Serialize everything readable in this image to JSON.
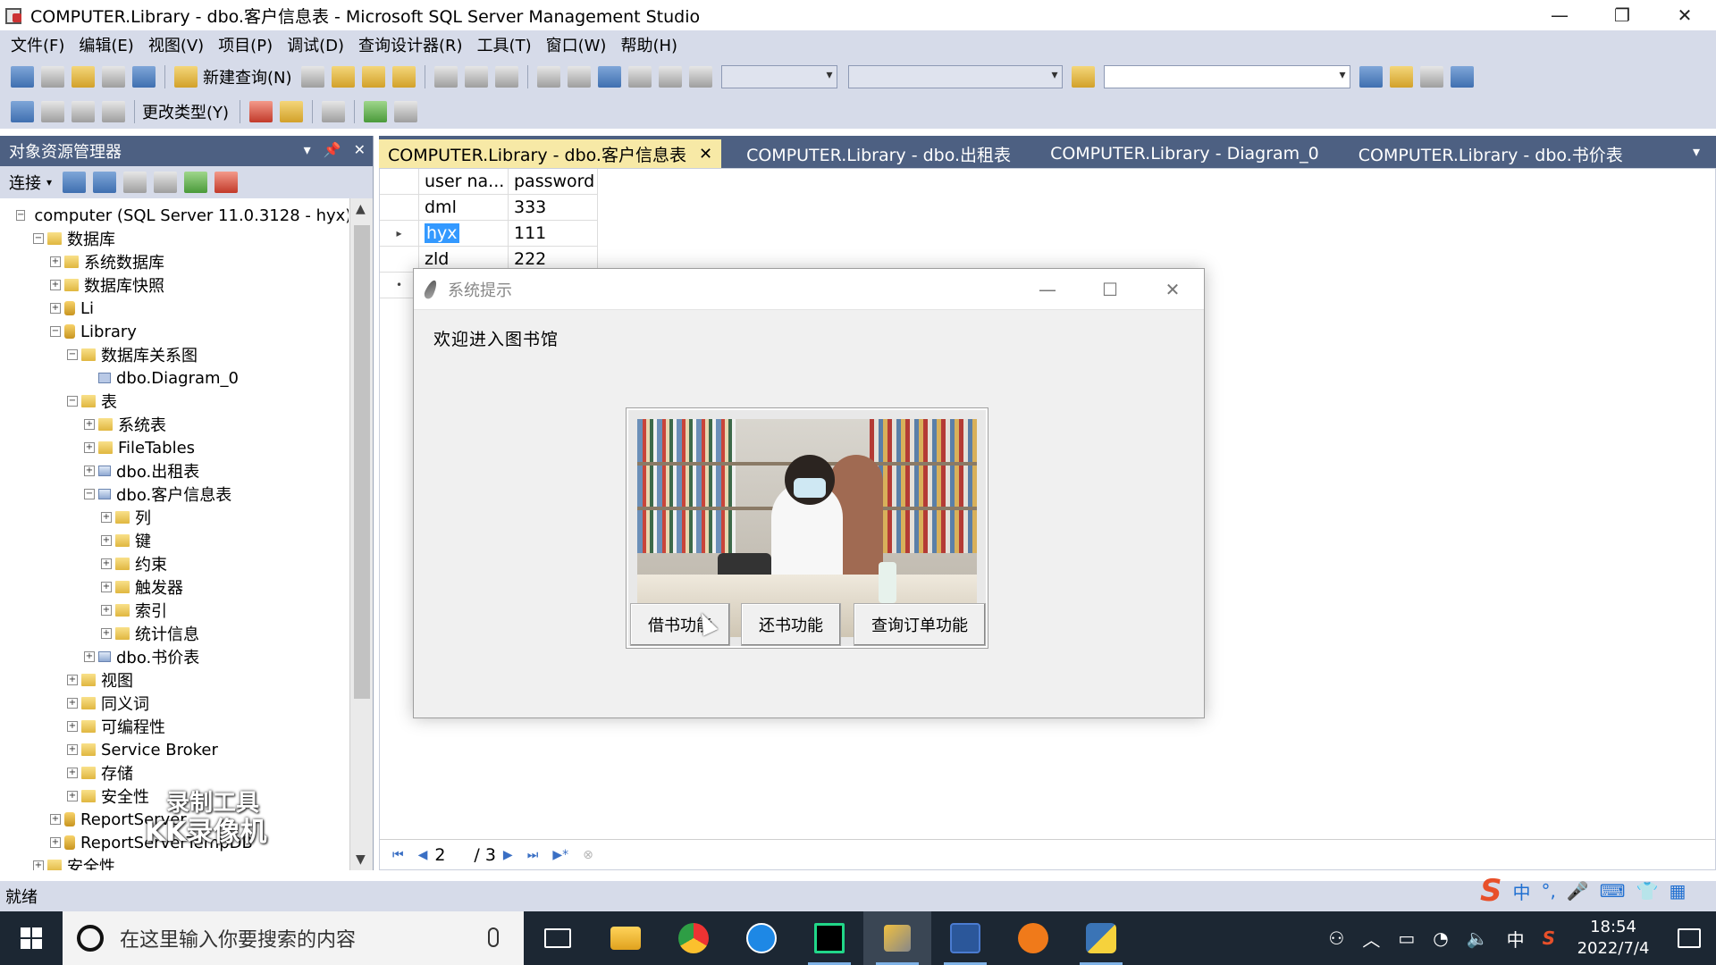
{
  "window": {
    "title": "COMPUTER.Library - dbo.客户信息表 - Microsoft SQL Server Management Studio",
    "minimize": "—",
    "restore": "❐",
    "close": "✕"
  },
  "menu": [
    "文件(F)",
    "编辑(E)",
    "视图(V)",
    "项目(P)",
    "调试(D)",
    "查询设计器(R)",
    "工具(T)",
    "窗口(W)",
    "帮助(H)"
  ],
  "toolbar": {
    "new_query": "新建查询(N)",
    "change_type": "更改类型(Y)"
  },
  "object_explorer": {
    "title": "对象资源管理器",
    "connect": "连接",
    "tree": [
      {
        "level": 0,
        "toggle": "−",
        "icon": "server",
        "label": "computer (SQL Server 11.0.3128 - hyx)"
      },
      {
        "level": 1,
        "toggle": "−",
        "icon": "folder",
        "label": "数据库"
      },
      {
        "level": 2,
        "toggle": "+",
        "icon": "folder",
        "label": "系统数据库"
      },
      {
        "level": 2,
        "toggle": "+",
        "icon": "folder",
        "label": "数据库快照"
      },
      {
        "level": 2,
        "toggle": "+",
        "icon": "db",
        "label": "Li"
      },
      {
        "level": 2,
        "toggle": "−",
        "icon": "db",
        "label": "Library"
      },
      {
        "level": 3,
        "toggle": "−",
        "icon": "folder",
        "label": "数据库关系图"
      },
      {
        "level": 4,
        "toggle": "",
        "icon": "diagram",
        "label": "dbo.Diagram_0"
      },
      {
        "level": 3,
        "toggle": "−",
        "icon": "folder",
        "label": "表"
      },
      {
        "level": 4,
        "toggle": "+",
        "icon": "folder",
        "label": "系统表"
      },
      {
        "level": 4,
        "toggle": "+",
        "icon": "folder",
        "label": "FileTables"
      },
      {
        "level": 4,
        "toggle": "+",
        "icon": "table",
        "label": "dbo.出租表"
      },
      {
        "level": 4,
        "toggle": "−",
        "icon": "table",
        "label": "dbo.客户信息表"
      },
      {
        "level": 5,
        "toggle": "+",
        "icon": "folder",
        "label": "列"
      },
      {
        "level": 5,
        "toggle": "+",
        "icon": "folder",
        "label": "键"
      },
      {
        "level": 5,
        "toggle": "+",
        "icon": "folder",
        "label": "约束"
      },
      {
        "level": 5,
        "toggle": "+",
        "icon": "folder",
        "label": "触发器"
      },
      {
        "level": 5,
        "toggle": "+",
        "icon": "folder",
        "label": "索引"
      },
      {
        "level": 5,
        "toggle": "+",
        "icon": "folder",
        "label": "统计信息"
      },
      {
        "level": 4,
        "toggle": "+",
        "icon": "table",
        "label": "dbo.书价表"
      },
      {
        "level": 3,
        "toggle": "+",
        "icon": "folder",
        "label": "视图"
      },
      {
        "level": 3,
        "toggle": "+",
        "icon": "folder",
        "label": "同义词"
      },
      {
        "level": 3,
        "toggle": "+",
        "icon": "folder",
        "label": "可编程性"
      },
      {
        "level": 3,
        "toggle": "+",
        "icon": "folder",
        "label": "Service Broker"
      },
      {
        "level": 3,
        "toggle": "+",
        "icon": "folder",
        "label": "存储"
      },
      {
        "level": 3,
        "toggle": "+",
        "icon": "folder",
        "label": "安全性"
      },
      {
        "level": 2,
        "toggle": "+",
        "icon": "db",
        "label": "ReportServer"
      },
      {
        "level": 2,
        "toggle": "+",
        "icon": "db",
        "label": "ReportServerTempDB"
      },
      {
        "level": 1,
        "toggle": "+",
        "icon": "folder",
        "label": "安全性"
      }
    ]
  },
  "watermark": {
    "line1": "录制工具",
    "line2": "KK录像机"
  },
  "tabs": [
    {
      "label": "COMPUTER.Library - dbo.客户信息表",
      "active": true
    },
    {
      "label": "COMPUTER.Library - dbo.出租表",
      "active": false
    },
    {
      "label": "COMPUTER.Library - Diagram_0",
      "active": false
    },
    {
      "label": "COMPUTER.Library - dbo.书价表",
      "active": false
    }
  ],
  "grid": {
    "columns": [
      "user na...",
      "password"
    ],
    "rows": [
      {
        "marker": "",
        "user": "dml",
        "password": "333"
      },
      {
        "marker": "▸",
        "user": "hyx",
        "password": "111",
        "selected": true
      },
      {
        "marker": "",
        "user": "zld",
        "password": "222"
      },
      {
        "marker": "•",
        "user": "",
        "password": ""
      }
    ]
  },
  "navigator": {
    "current_page": "2",
    "total": "/ 3"
  },
  "dialog": {
    "title": "系统提示",
    "welcome": "欢迎进入图书馆",
    "buttons": {
      "borrow": "借书功能",
      "return": "还书功能",
      "query": "查询订单功能"
    }
  },
  "status": {
    "text": "就绪"
  },
  "ime": {
    "lang": "中"
  },
  "taskbar": {
    "search_placeholder": "在这里输入你要搜索的内容",
    "time": "18:54",
    "date": "2022/7/4",
    "ime_lang": "中"
  },
  "colors": {
    "chrome": "#d6dbe9",
    "panel_header": "#4d6082",
    "active_tab": "#f7e9a6",
    "selection": "#3399ff",
    "taskbar": "#1c2733"
  }
}
